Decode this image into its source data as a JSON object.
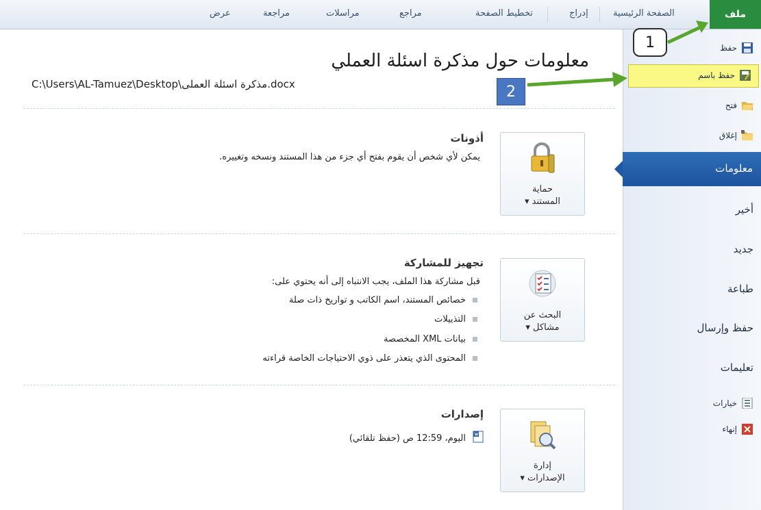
{
  "ribbon": {
    "tabs": [
      {
        "label": "ملف"
      },
      {
        "label": "الصفحة الرئيسية"
      },
      {
        "label": "إدراج"
      },
      {
        "label": "تخطيط الصفحة"
      },
      {
        "label": "مراجع"
      },
      {
        "label": "مراسلات"
      },
      {
        "label": "مراجعة"
      },
      {
        "label": "عرض"
      }
    ]
  },
  "sidebar": {
    "save": "حفظ",
    "save_as": "حفظ باسم",
    "open": "فتح",
    "close": "إغلاق",
    "info": "معلومات",
    "recent": "أخير",
    "new": "جديد",
    "print": "طباعة",
    "save_send": "حفظ وإرسال",
    "help": "تعليمات",
    "options": "خيارات",
    "exit": "إنهاء"
  },
  "main": {
    "title": "معلومات حول مذكرة اسئلة العملي",
    "path": "C:\\Users\\AL-Tamuez\\Desktop\\مذكرة اسئلة العملى.docx"
  },
  "permissions": {
    "button": [
      "حماية",
      "المستند ▾"
    ],
    "title": "أذونات",
    "text": "يمكن لأي شخص أن يقوم بفتح أي جزء من هذا المستند ونسخه وتغييره."
  },
  "prepare": {
    "button": [
      "البحث عن",
      "مشاكل ▾"
    ],
    "title": "تجهيز للمشاركة",
    "text": "قبل مشاركة هذا الملف، يجب الانتباه إلى أنه يحتوي على:",
    "items": [
      "خصائص المستند، اسم الكاتب و تواريخ ذات صلة",
      "التذييلات",
      "بيانات XML المخصصة",
      "المحتوى الذي يتعذر على ذوي الاحتياجات الخاصة قراءته"
    ]
  },
  "versions": {
    "button": [
      "إدارة",
      "الإصدارات ▾"
    ],
    "title": "إصدارات",
    "entry": "اليوم، 12:59 ص (حفظ تلقائي)"
  },
  "annotations": {
    "step1": "1",
    "step2": "2",
    "arrow_color": "#5aa52d"
  }
}
